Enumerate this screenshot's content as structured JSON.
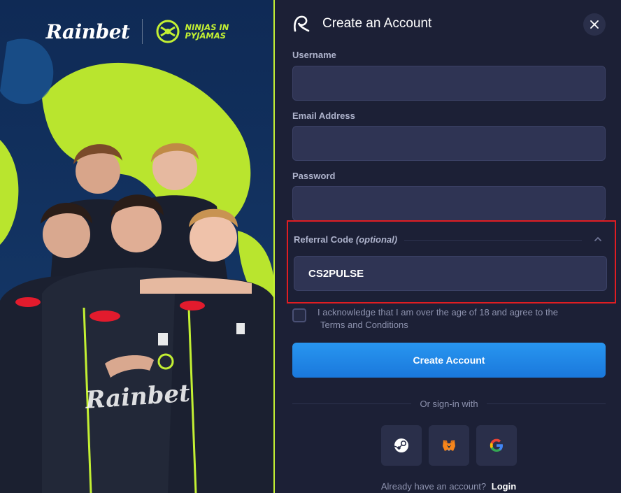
{
  "promo": {
    "brand_logo": "Rainbet",
    "partner_logo_line1": "NINJAS IN",
    "partner_logo_line2": "PYJAMAS",
    "jersey_text": "Rainbet"
  },
  "modal": {
    "title": "Create an Account",
    "close_icon": "close-icon",
    "fields": {
      "username_label": "Username",
      "username_value": "",
      "email_label": "Email Address",
      "email_value": "",
      "password_label": "Password",
      "password_value": ""
    },
    "referral": {
      "label": "Referral Code",
      "label_optional": "(optional)",
      "value": "CS2PULSE",
      "highlight_color": "#e01d22"
    },
    "acknowledge": {
      "text": "I acknowledge that I am over the age of 18 and agree to the",
      "terms_link": "Terms and Conditions",
      "checked": false
    },
    "create_button": "Create Account",
    "or_text": "Or sign-in with",
    "social": [
      {
        "icon": "steam-icon"
      },
      {
        "icon": "metamask-icon"
      },
      {
        "icon": "google-icon"
      }
    ],
    "login_prompt": "Already have an account?",
    "login_link": "Login"
  },
  "colors": {
    "modal_bg": "#1c2036",
    "input_bg": "#2f3454",
    "accent_blue": "#1a78dc",
    "accent_lime": "#c3f033"
  }
}
